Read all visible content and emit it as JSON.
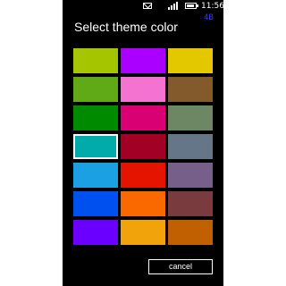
{
  "status_bar": {
    "time": "11:56",
    "icons": [
      "mail-icon",
      "signal-icon",
      "battery-icon"
    ]
  },
  "corner_badge": "4B",
  "title": "Select theme color",
  "swatches": [
    {
      "name": "swatch-lime",
      "color": "#a5c500"
    },
    {
      "name": "swatch-violet",
      "color": "#aa00ff"
    },
    {
      "name": "swatch-yellow",
      "color": "#e3c800"
    },
    {
      "name": "swatch-green",
      "color": "#60a917"
    },
    {
      "name": "swatch-pink",
      "color": "#f472d0"
    },
    {
      "name": "swatch-brown",
      "color": "#825a2c"
    },
    {
      "name": "swatch-emerald",
      "color": "#008a00"
    },
    {
      "name": "swatch-magenta",
      "color": "#d80073"
    },
    {
      "name": "swatch-olive",
      "color": "#6d8764"
    },
    {
      "name": "swatch-teal",
      "color": "#00aba9",
      "selected": true
    },
    {
      "name": "swatch-crimson",
      "color": "#a20025"
    },
    {
      "name": "swatch-steel",
      "color": "#647687"
    },
    {
      "name": "swatch-cyan",
      "color": "#1ba1e2"
    },
    {
      "name": "swatch-red",
      "color": "#e51400"
    },
    {
      "name": "swatch-mauve",
      "color": "#76608a"
    },
    {
      "name": "swatch-cobalt",
      "color": "#0050ef"
    },
    {
      "name": "swatch-orange",
      "color": "#fa6800"
    },
    {
      "name": "swatch-taupe",
      "color": "#7a3b3f"
    },
    {
      "name": "swatch-indigo",
      "color": "#6a00ff"
    },
    {
      "name": "swatch-amber",
      "color": "#f0a30a"
    },
    {
      "name": "swatch-sienna",
      "color": "#c06000"
    }
  ],
  "cancel_label": "cancel"
}
